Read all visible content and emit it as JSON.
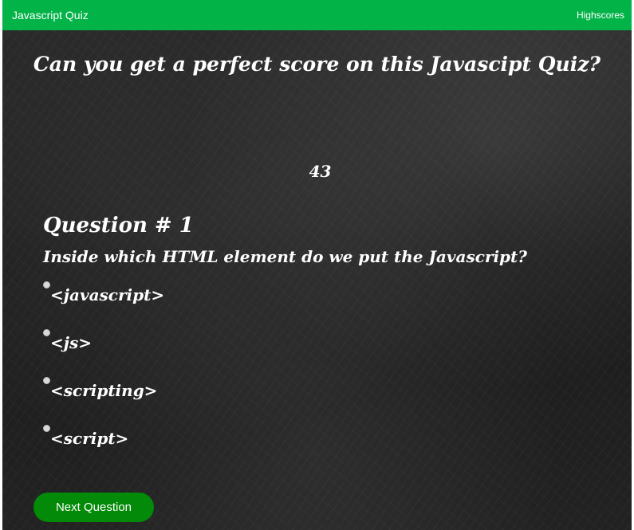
{
  "navbar": {
    "brand": "Javascript Quiz",
    "highscores_link": "Highscores"
  },
  "headline": "Can you get a perfect score on this Javascipt Quiz?",
  "timer": "43",
  "question": {
    "number_label": "Question # 1",
    "text": "Inside which HTML element do we put the Javascript?",
    "choices": [
      "<javascript>",
      "<js>",
      "<scripting>",
      "<script>"
    ]
  },
  "next_button": "Next Question",
  "colors": {
    "navbar": "#02b348",
    "button": "#028a08",
    "chalkboard": "#1f1f1f",
    "text": "#ffffff"
  }
}
